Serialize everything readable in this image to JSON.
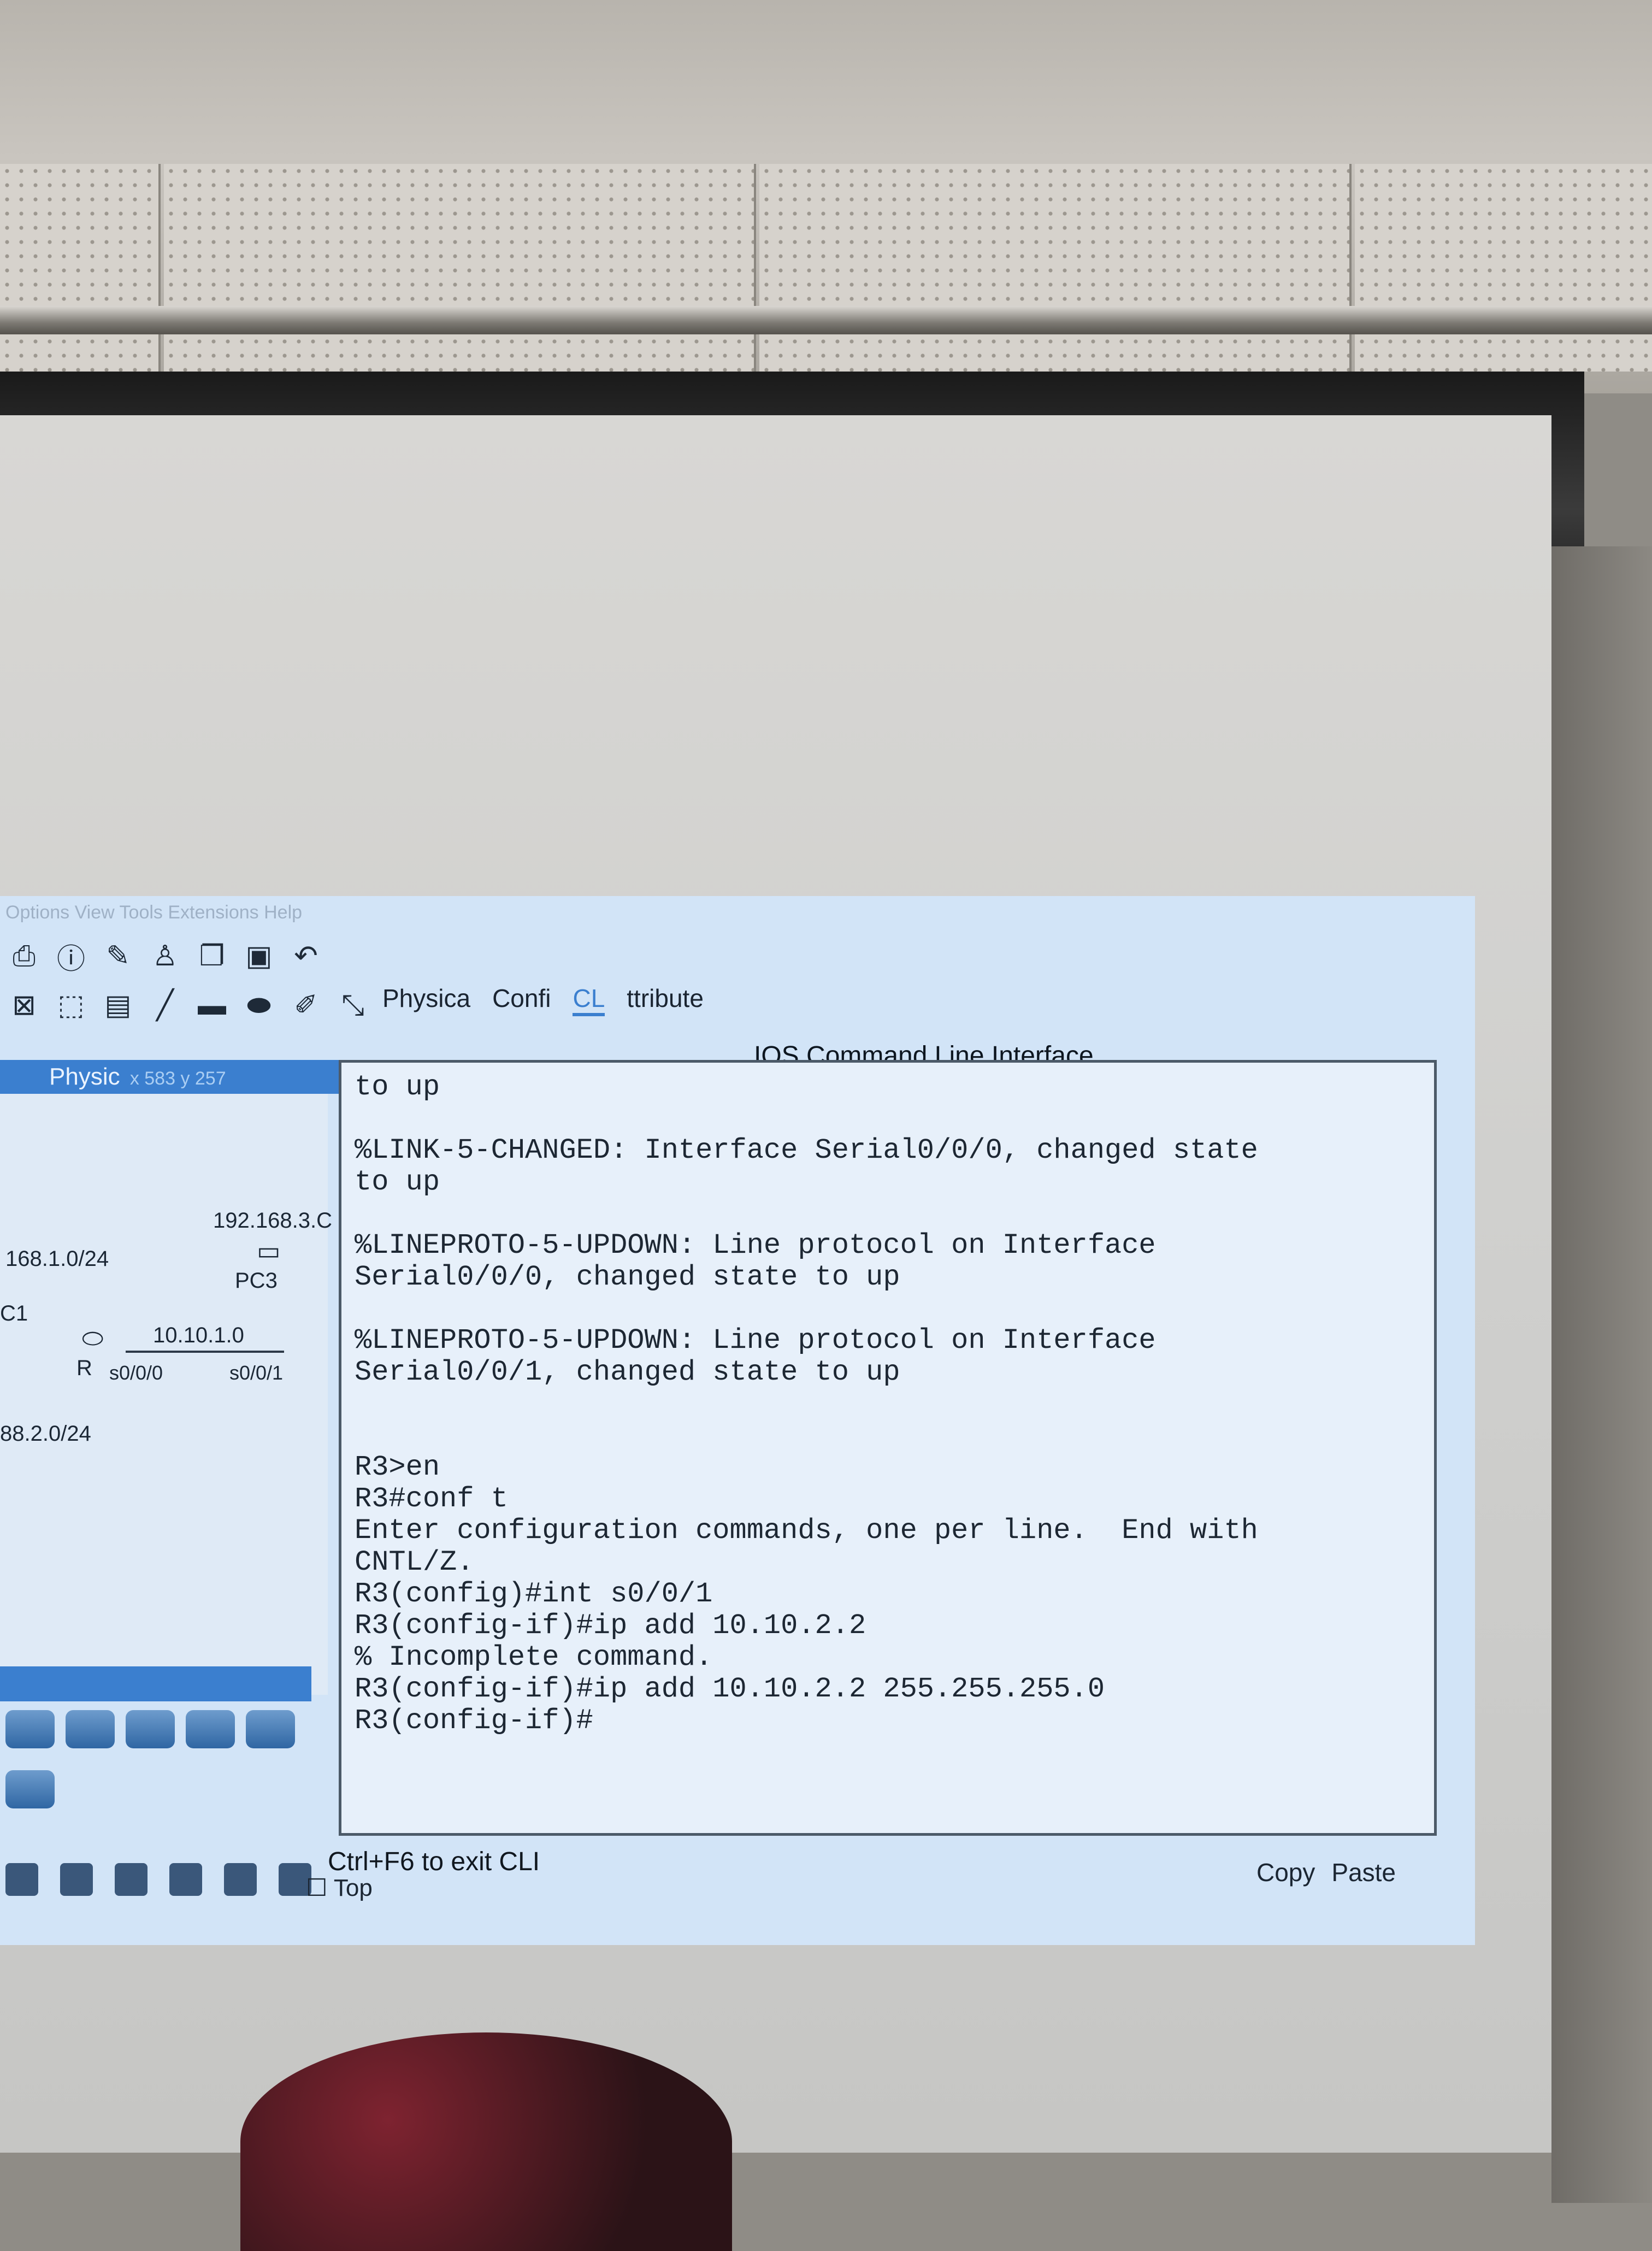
{
  "menubar": {
    "text": "Options View Tools Extensions Help"
  },
  "toolbar": {
    "row1_icons": [
      "print-icon",
      "info-icon",
      "draw-icon",
      "user-icon",
      "copy-icon",
      "paste-icon",
      "undo-icon"
    ],
    "row2_icons": [
      "select-icon",
      "marquee-icon",
      "note-icon",
      "line-icon",
      "rectangle-icon",
      "ellipse-icon",
      "pencil-icon",
      "resize-icon"
    ]
  },
  "logical_bar": {
    "label": "Physic",
    "coords": "x 583 y 257"
  },
  "tabs": [
    {
      "label": "Physica"
    },
    {
      "label": "Confi"
    },
    {
      "label": "CL",
      "active": true
    },
    {
      "label": "ttribute"
    }
  ],
  "topology": {
    "net_top": "192.168.3.C",
    "net_left": "168.1.0/24",
    "pc_label": "PC3",
    "pc_left": "C1",
    "link_net": "10.10.1.0",
    "router_label": "R",
    "iface_left": "s0/0/0",
    "iface_right": "s0/0/1",
    "net_bottom": "88.2.0/24"
  },
  "cli": {
    "title": "IOS Command Line Interface",
    "lines": [
      "to up",
      "",
      "%LINK-5-CHANGED: Interface Serial0/0/0, changed state",
      "to up",
      "",
      "%LINEPROTO-5-UPDOWN: Line protocol on Interface",
      "Serial0/0/0, changed state to up",
      "",
      "%LINEPROTO-5-UPDOWN: Line protocol on Interface",
      "Serial0/0/1, changed state to up",
      "",
      "",
      "R3>en",
      "R3#conf t",
      "Enter configuration commands, one per line.  End with",
      "CNTL/Z.",
      "R3(config)#int s0/0/1",
      "R3(config-if)#ip add 10.10.2.2",
      "% Incomplete command.",
      "R3(config-if)#ip add 10.10.2.2 255.255.255.0",
      "R3(config-if)#"
    ],
    "hint": "Ctrl+F6 to exit CLI",
    "copy_label": "Copy",
    "paste_label": "Paste"
  },
  "top_checkbox": "Top"
}
